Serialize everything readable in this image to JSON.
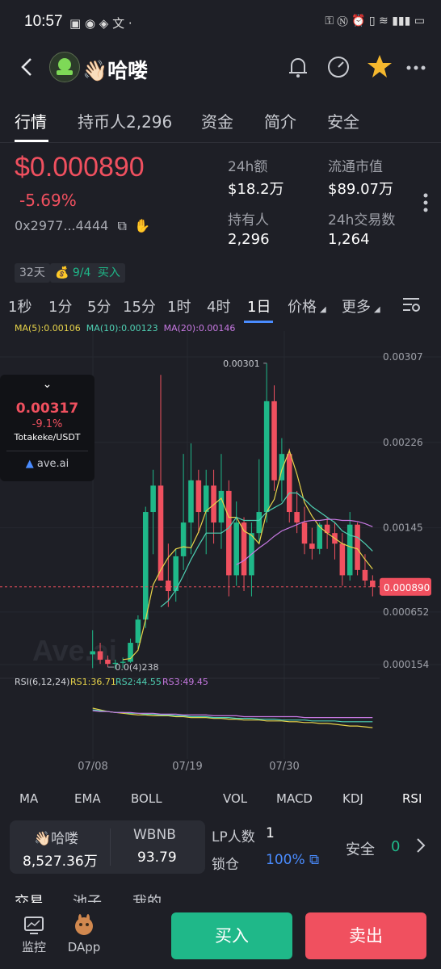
{
  "status": {
    "time": "10:57"
  },
  "header": {
    "title": "👋🏻哈喽"
  },
  "tabs": [
    {
      "label": "行情"
    },
    {
      "label": "持币人2,296"
    },
    {
      "label": "资金"
    },
    {
      "label": "简介"
    },
    {
      "label": "安全"
    }
  ],
  "token": {
    "price": "$0.000890",
    "change": "-5.69%",
    "address": "0x2977...4444"
  },
  "stats": {
    "vol24_label": "24h额",
    "vol24_value": "$18.2万",
    "mcap_label": "流通市值",
    "mcap_value": "$89.07万",
    "holders_label": "持有人",
    "holders_value": "2,296",
    "tx24_label": "24h交易数",
    "tx24_value": "1,264"
  },
  "chips": {
    "age": "32天",
    "buy_ratio": "9/4",
    "buy_label": "买入"
  },
  "intervals": [
    "1秒",
    "1分",
    "5分",
    "15分",
    "1时",
    "4时",
    "1日",
    "价格",
    "更多"
  ],
  "ma_legend": {
    "ma5": "MA(5):0.00106",
    "ma10": "MA(10):0.00123",
    "ma20": "MA(20):0.00146"
  },
  "colors": {
    "up": "#1fb889",
    "down": "#f0505f",
    "ma5": "#e8d44a",
    "ma10": "#4fd1b4",
    "ma20": "#c879e3",
    "accent": "#4a8cff"
  },
  "popup": {
    "price": "0.00317",
    "change": "-9.1%",
    "pair": "Totakeke/USDT",
    "brand": "ave.ai"
  },
  "chart": {
    "high_label": "0.00301",
    "low_label": "0.0(4)238",
    "watermark": "Ave.ai",
    "current_price_tag": "0.000890",
    "y_labels": [
      "0.00307",
      "0.00226",
      "0.00145",
      "0.000652",
      "0.000154"
    ],
    "x_labels": [
      "07/08",
      "07/19",
      "07/30"
    ],
    "rsi_legend": {
      "title": "RSI(6,12,24)",
      "rs1": "RS1:36.71",
      "rs2": "RS2:44.55",
      "rs3": "RS3:49.45"
    }
  },
  "chart_data": {
    "type": "candlestick",
    "candles": [
      {
        "o": 0.00025,
        "h": 0.00048,
        "l": 0.00012,
        "c": 0.00028
      },
      {
        "o": 0.00028,
        "h": 0.00036,
        "l": 0.00016,
        "c": 0.0002
      },
      {
        "o": 0.0002,
        "h": 0.00024,
        "l": 0.00013,
        "c": 0.00016
      },
      {
        "o": 0.00016,
        "h": 0.0002,
        "l": 0.00011,
        "c": 0.00017
      },
      {
        "o": 0.00017,
        "h": 0.00022,
        "l": 0.00012,
        "c": 0.00018
      },
      {
        "o": 0.00018,
        "h": 0.0004,
        "l": 0.00017,
        "c": 0.00036
      },
      {
        "o": 0.00036,
        "h": 0.00062,
        "l": 0.0003,
        "c": 0.00058
      },
      {
        "o": 0.00058,
        "h": 0.00165,
        "l": 0.0005,
        "c": 0.0016
      },
      {
        "o": 0.0016,
        "h": 0.002,
        "l": 0.0012,
        "c": 0.00185
      },
      {
        "o": 0.00185,
        "h": 0.0029,
        "l": 0.00095,
        "c": 0.00095
      },
      {
        "o": 0.00095,
        "h": 0.0013,
        "l": 0.0007,
        "c": 0.00085
      },
      {
        "o": 0.00085,
        "h": 0.00125,
        "l": 0.00075,
        "c": 0.00118
      },
      {
        "o": 0.00118,
        "h": 0.00215,
        "l": 0.00105,
        "c": 0.0015
      },
      {
        "o": 0.0015,
        "h": 0.00225,
        "l": 0.0012,
        "c": 0.0019
      },
      {
        "o": 0.0019,
        "h": 0.002,
        "l": 0.0014,
        "c": 0.0016
      },
      {
        "o": 0.0016,
        "h": 0.002,
        "l": 0.0012,
        "c": 0.00185
      },
      {
        "o": 0.00185,
        "h": 0.002,
        "l": 0.0013,
        "c": 0.0015
      },
      {
        "o": 0.0015,
        "h": 0.00215,
        "l": 0.00125,
        "c": 0.0018
      },
      {
        "o": 0.0018,
        "h": 0.0019,
        "l": 0.0008,
        "c": 0.001
      },
      {
        "o": 0.001,
        "h": 0.0017,
        "l": 0.0009,
        "c": 0.0015
      },
      {
        "o": 0.0015,
        "h": 0.00155,
        "l": 0.00085,
        "c": 0.001
      },
      {
        "o": 0.001,
        "h": 0.0015,
        "l": 0.0008,
        "c": 0.0014
      },
      {
        "o": 0.0014,
        "h": 0.0021,
        "l": 0.0013,
        "c": 0.0016
      },
      {
        "o": 0.0016,
        "h": 0.00301,
        "l": 0.0015,
        "c": 0.00265
      },
      {
        "o": 0.00265,
        "h": 0.0028,
        "l": 0.0018,
        "c": 0.0019
      },
      {
        "o": 0.0019,
        "h": 0.0023,
        "l": 0.0017,
        "c": 0.00215
      },
      {
        "o": 0.00215,
        "h": 0.0022,
        "l": 0.0015,
        "c": 0.0016
      },
      {
        "o": 0.0016,
        "h": 0.0018,
        "l": 0.0014,
        "c": 0.0015
      },
      {
        "o": 0.0015,
        "h": 0.00165,
        "l": 0.0012,
        "c": 0.0013
      },
      {
        "o": 0.0013,
        "h": 0.00145,
        "l": 0.00115,
        "c": 0.00125
      },
      {
        "o": 0.00125,
        "h": 0.0015,
        "l": 0.0012,
        "c": 0.00148
      },
      {
        "o": 0.00148,
        "h": 0.00155,
        "l": 0.00125,
        "c": 0.0014
      },
      {
        "o": 0.0014,
        "h": 0.0015,
        "l": 0.00115,
        "c": 0.0013
      },
      {
        "o": 0.0013,
        "h": 0.0014,
        "l": 0.0009,
        "c": 0.001
      },
      {
        "o": 0.001,
        "h": 0.0016,
        "l": 0.00095,
        "c": 0.00148
      },
      {
        "o": 0.00148,
        "h": 0.0015,
        "l": 0.001,
        "c": 0.00105
      },
      {
        "o": 0.00105,
        "h": 0.0012,
        "l": 0.0009,
        "c": 0.00095
      },
      {
        "o": 0.00095,
        "h": 0.001,
        "l": 0.0008,
        "c": 0.00089
      }
    ],
    "ma5": [
      null,
      null,
      null,
      null,
      0.0002,
      0.00021,
      0.00029,
      0.00058,
      0.00091,
      0.00105,
      0.00117,
      0.00125,
      0.00127,
      0.00126,
      0.00141,
      0.00161,
      0.00167,
      0.00173,
      0.00155,
      0.00155,
      0.00142,
      0.00138,
      0.0013,
      0.0016,
      0.00172,
      0.002,
      0.00218,
      0.00196,
      0.00169,
      0.00156,
      0.00146,
      0.0014,
      0.00135,
      0.0013,
      0.00127,
      0.00125,
      0.00115,
      0.00106
    ],
    "ma10": [
      null,
      null,
      null,
      null,
      null,
      null,
      null,
      null,
      null,
      0.0007,
      0.00076,
      0.00086,
      0.001,
      0.00115,
      0.00128,
      0.0014,
      0.0014,
      0.0014,
      0.00145,
      0.00155,
      0.00152,
      0.00152,
      0.00152,
      0.0016,
      0.00164,
      0.00168,
      0.00178,
      0.00178,
      0.00172,
      0.00165,
      0.0016,
      0.00155,
      0.0015,
      0.00142,
      0.00138,
      0.00136,
      0.0013,
      0.00123
    ],
    "ma20": [
      null,
      null,
      null,
      null,
      null,
      null,
      null,
      null,
      null,
      null,
      null,
      null,
      null,
      null,
      null,
      null,
      null,
      null,
      null,
      0.0011,
      0.00114,
      0.0012,
      0.00126,
      0.00131,
      0.00137,
      0.00142,
      0.00145,
      0.00148,
      0.00151,
      0.00152,
      0.00152,
      0.00153,
      0.00153,
      0.00152,
      0.00152,
      0.00151,
      0.00149,
      0.00146
    ],
    "rsi1": [
      60,
      58,
      56,
      55,
      54,
      53,
      52,
      52,
      51,
      51,
      51,
      50,
      50,
      49,
      49,
      49,
      48,
      48,
      47,
      47,
      46,
      46,
      46,
      45,
      45,
      45,
      44,
      44,
      43,
      43,
      42,
      42,
      41,
      40,
      39,
      39,
      38,
      37
    ],
    "rsi2": [
      58,
      57,
      56,
      55,
      55,
      54,
      54,
      53,
      53,
      52,
      52,
      51,
      51,
      50,
      50,
      50,
      49,
      49,
      49,
      48,
      48,
      48,
      47,
      47,
      47,
      46,
      46,
      46,
      46,
      45,
      45,
      45,
      45,
      44,
      44,
      44,
      44,
      44
    ],
    "rsi3": [
      57,
      56,
      56,
      55,
      55,
      55,
      54,
      54,
      54,
      53,
      53,
      53,
      52,
      52,
      52,
      52,
      51,
      51,
      51,
      51,
      50,
      50,
      50,
      50,
      50,
      50,
      50,
      50,
      49,
      49,
      49,
      49,
      49,
      49,
      49,
      49,
      49,
      49
    ]
  },
  "indicators": [
    "MA",
    "EMA",
    "BOLL",
    "VOL",
    "MACD",
    "KDJ",
    "RSI"
  ],
  "pool": {
    "token_label": "👋🏻哈喽",
    "token_amount": "8,527.36万",
    "quote_label": "WBNB",
    "quote_amount": "93.79",
    "lp_label": "LP人数",
    "lp_count": "1",
    "lock_label": "锁仓",
    "lock_pct": "100%",
    "safety_label": "安全",
    "safety_count": "0"
  },
  "lower_tabs": [
    "交易",
    "池子",
    "我的"
  ],
  "bottom_nav": {
    "monitor": "监控",
    "dapp": "DApp",
    "buy": "买入",
    "sell": "卖出"
  }
}
